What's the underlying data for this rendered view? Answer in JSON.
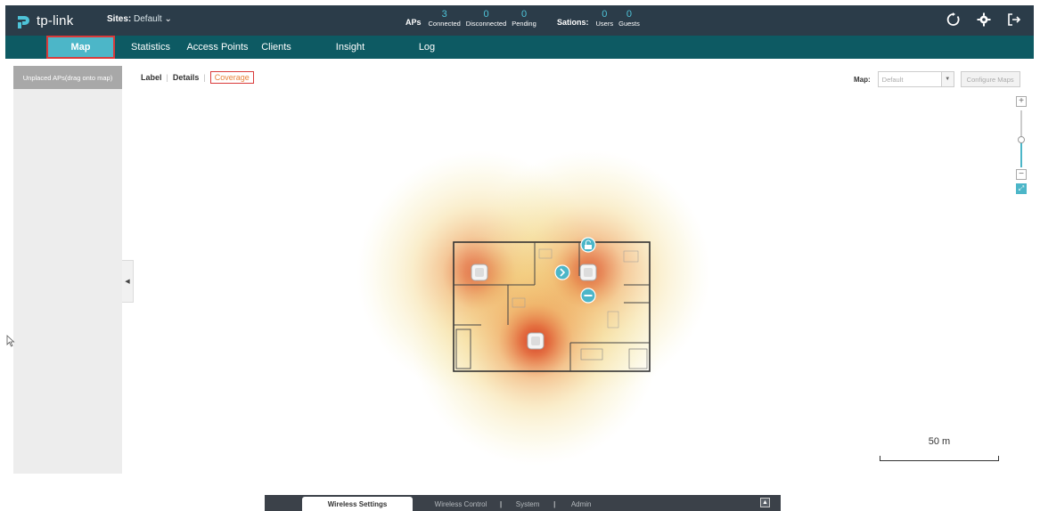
{
  "header": {
    "logo_text": "tp-link",
    "sites_label": "Sites:",
    "sites_value": "Default",
    "aps": {
      "label": "APs",
      "stats": [
        {
          "num": "3",
          "label": "Connected"
        },
        {
          "num": "0",
          "label": "Disconnected"
        },
        {
          "num": "0",
          "label": "Pending"
        }
      ]
    },
    "stations": {
      "label": "Sations:",
      "stats": [
        {
          "num": "0",
          "label": "Users"
        },
        {
          "num": "0",
          "label": "Guests"
        }
      ]
    },
    "icons": [
      "refresh-icon",
      "gear-icon",
      "logout-icon"
    ]
  },
  "nav": {
    "tabs": [
      {
        "label": "Map",
        "active": true
      },
      {
        "label": "Statistics"
      },
      {
        "label": "Access Points"
      },
      {
        "label": "Clients"
      },
      {
        "label": "Insight"
      },
      {
        "label": "Log"
      }
    ]
  },
  "left_panel": {
    "unplaced_label": "Unplaced APs(drag onto map)"
  },
  "view_tabs": {
    "label": "Label",
    "details": "Details",
    "coverage": "Coverage",
    "active": "Coverage"
  },
  "map_select": {
    "label": "Map:",
    "value": "Default",
    "configure_label": "Configure Maps"
  },
  "zoom": {
    "plus": "+",
    "minus": "−",
    "level": 0.5
  },
  "scale": {
    "label": "50 m"
  },
  "bottom_bar": {
    "tabs": [
      {
        "label": "Wireless Settings",
        "active": true
      },
      {
        "label": "Wireless Control"
      },
      {
        "label": "System"
      },
      {
        "label": "Admin"
      }
    ]
  },
  "colors": {
    "header_bg": "#2b3c49",
    "nav_bg": "#0d5a63",
    "accent": "#4cb6c8",
    "highlight_border": "#d93a3a",
    "coverage_text": "#e8833b"
  }
}
